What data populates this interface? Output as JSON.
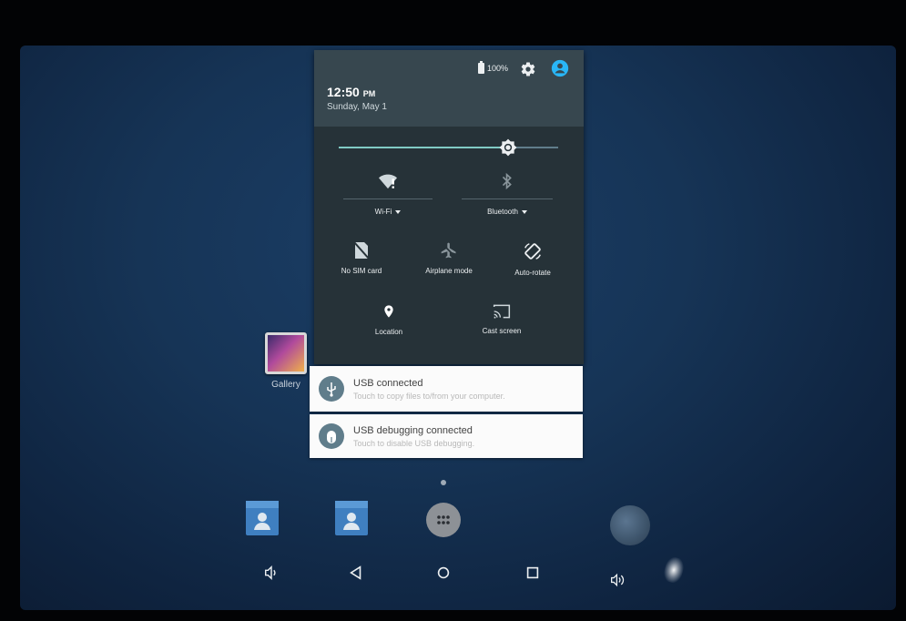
{
  "status": {
    "battery_pct": "100%",
    "icons": [
      "battery-icon",
      "settings-gear-icon",
      "user-account-icon"
    ]
  },
  "header": {
    "time": "12:50",
    "ampm": "PM",
    "date": "Sunday, May 1"
  },
  "brightness": {
    "level": 0.78
  },
  "tiles": {
    "wifi": {
      "label": "Wi-Fi",
      "icon": "wifi-alert-icon"
    },
    "bluetooth": {
      "label": "Bluetooth",
      "icon": "bluetooth-icon"
    },
    "no_sim": {
      "label": "No SIM card",
      "icon": "no-sim-icon"
    },
    "airplane": {
      "label": "Airplane mode",
      "icon": "airplane-icon"
    },
    "autorotate": {
      "label": "Auto-rotate",
      "icon": "autorotate-icon"
    },
    "location": {
      "label": "Location",
      "icon": "location-pin-icon"
    },
    "cast": {
      "label": "Cast screen",
      "icon": "cast-icon"
    }
  },
  "notifications": [
    {
      "title": "USB connected",
      "subtitle": "Touch to copy files to/from your computer.",
      "icon": "usb-icon"
    },
    {
      "title": "USB debugging connected",
      "subtitle": "Touch to disable USB debugging.",
      "icon": "android-debug-icon"
    }
  ],
  "home": {
    "gallery_label": "Gallery"
  },
  "colors": {
    "panel_bg": "#263238",
    "header_bg": "#37474f",
    "accent_teal": "#80cbc4",
    "user_icon_blue": "#29b6f6",
    "notification_icon": "#607d8b"
  }
}
